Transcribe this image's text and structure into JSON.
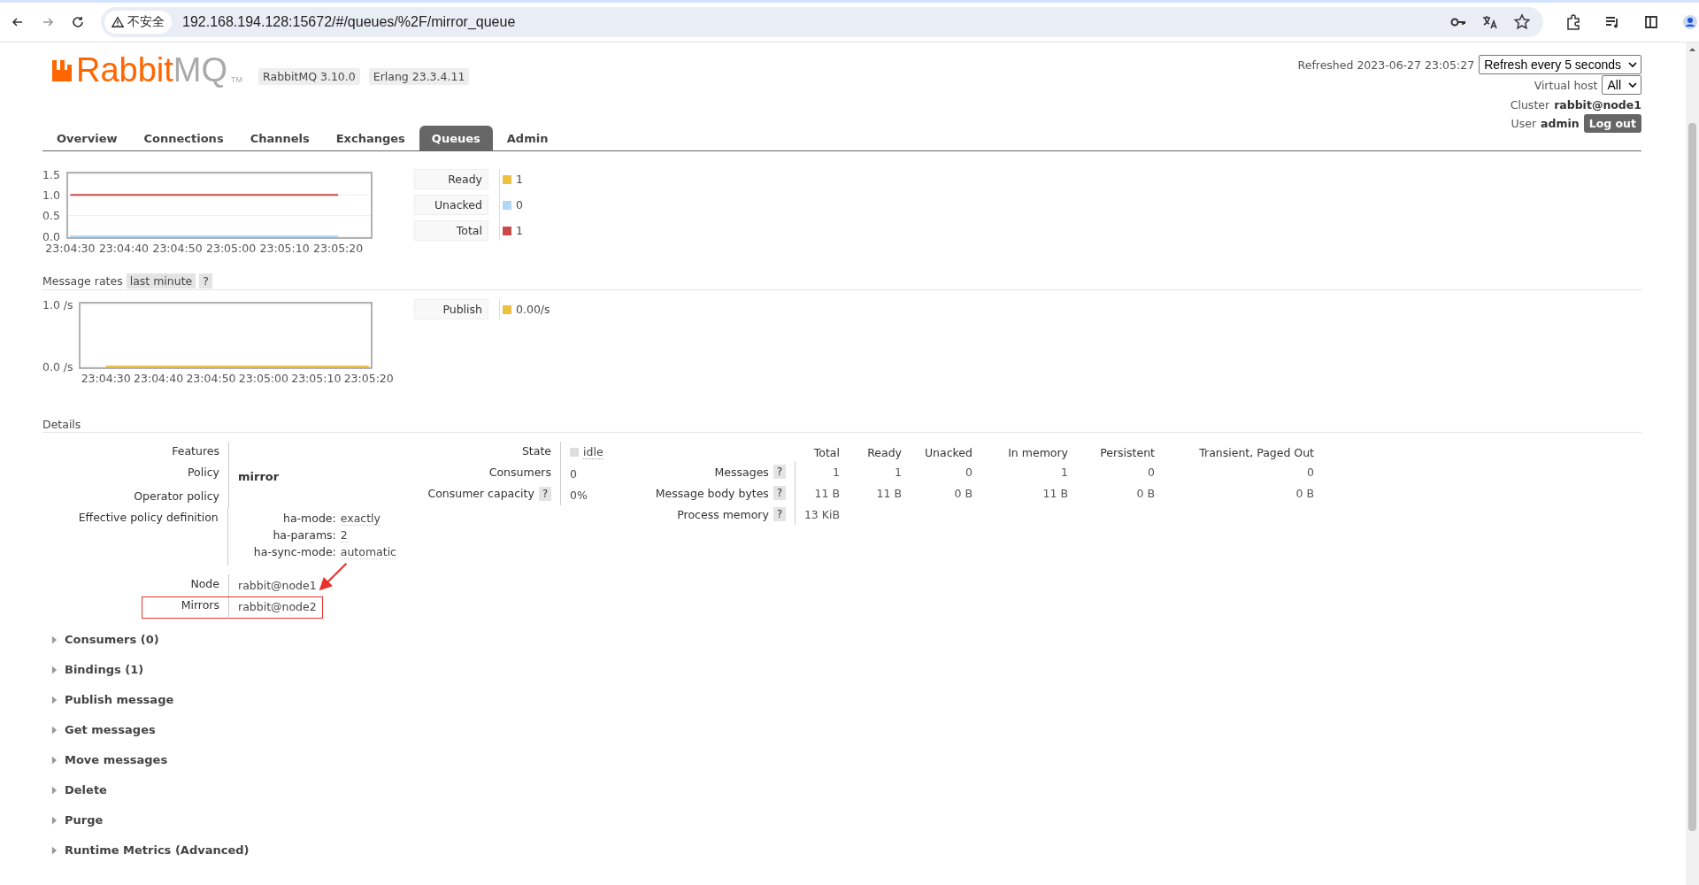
{
  "browser": {
    "security": "不安全",
    "url": "192.168.194.128:15672/#/queues/%2F/mirror_queue"
  },
  "header": {
    "logo": {
      "brand": "Rabbit",
      "suffix": "MQ",
      "tm": "TM"
    },
    "badges": [
      "RabbitMQ 3.10.0",
      "Erlang 23.3.4.11"
    ],
    "refreshed": "Refreshed 2023-06-27 23:05:27",
    "refresh_select": "Refresh every 5 seconds",
    "vhost_label": "Virtual host",
    "vhost_select": "All",
    "cluster_label": "Cluster",
    "cluster": "rabbit@node1",
    "user_label": "User",
    "user": "admin",
    "logout": "Log out"
  },
  "tabs": [
    {
      "label": "Overview",
      "selected": false
    },
    {
      "label": "Connections",
      "selected": false
    },
    {
      "label": "Channels",
      "selected": false
    },
    {
      "label": "Exchanges",
      "selected": false
    },
    {
      "label": "Queues",
      "selected": true
    },
    {
      "label": "Admin",
      "selected": false
    }
  ],
  "queued": {
    "legend": [
      {
        "value": "1"
      },
      {
        "value": "0"
      },
      {
        "value": "1"
      }
    ],
    "chart_data": {
      "type": "line",
      "categories": [
        "23:04:30",
        "23:04:40",
        "23:04:50",
        "23:05:00",
        "23:05:10",
        "23:05:20"
      ],
      "series": [
        {
          "name": "Ready",
          "color": "#edc240",
          "values": [
            null,
            null,
            null,
            null,
            null,
            null
          ]
        },
        {
          "name": "Unacked",
          "color": "#afd8f8",
          "values": [
            0,
            0,
            0,
            0,
            0,
            0
          ]
        },
        {
          "name": "Total",
          "color": "#cb4b4b",
          "values": [
            1,
            1,
            1,
            1,
            1,
            1
          ]
        }
      ],
      "ylim": [
        0,
        1.5
      ],
      "yticks": [
        {
          "value": 0,
          "label": "0.0"
        },
        {
          "value": 0.5,
          "label": "0.5"
        },
        {
          "value": 1,
          "label": "1.0"
        },
        {
          "value": 1.5,
          "label": "1.5"
        }
      ]
    }
  },
  "rates": {
    "title": "Message rates",
    "range": "last minute",
    "help": "?",
    "legend": [
      {
        "value": "0.00/s"
      }
    ],
    "chart_data": {
      "type": "line",
      "categories": [
        "23:04:30",
        "23:04:40",
        "23:04:50",
        "23:05:00",
        "23:05:10",
        "23:05:20"
      ],
      "series": [
        {
          "name": "Publish",
          "color": "#edc240",
          "values": [
            0,
            0,
            0,
            0,
            0,
            0
          ]
        }
      ],
      "ylim": [
        0,
        1
      ],
      "yticks": [
        {
          "value": 0,
          "label": "0.0 /s"
        },
        {
          "value": 1,
          "label": "1.0 /s"
        }
      ]
    }
  },
  "details": {
    "title": "Details",
    "left": [
      {
        "label": "Features",
        "kind": "plain"
      },
      {
        "label": "Policy",
        "kind": "bold",
        "value": "mirror"
      },
      {
        "label": "Operator policy",
        "kind": "plain"
      },
      {
        "label": "Effective policy definition",
        "kind": "definition",
        "children": [
          {
            "key": "ha-mode:",
            "value": "exactly"
          },
          {
            "key": "ha-params:",
            "value": "2"
          },
          {
            "key": "ha-sync-mode:",
            "value": "automatic"
          }
        ]
      },
      {
        "label": "Node",
        "kind": "plain",
        "value": "rabbit@node1"
      },
      {
        "label": "Mirrors",
        "kind": "plain",
        "value": "rabbit@node2",
        "highlighted": true
      }
    ],
    "middle": [
      {
        "label": "State",
        "kind": "state",
        "value": "idle"
      },
      {
        "label": "Consumers",
        "kind": "plain",
        "value": "0"
      },
      {
        "label": "Consumer capacity",
        "kind": "plain",
        "help": "?",
        "value": "0%"
      }
    ],
    "stats": {
      "columns": [
        "Total",
        "Ready",
        "Unacked",
        "In memory",
        "Persistent",
        "Transient, Paged Out"
      ],
      "rows": [
        {
          "label": "Messages",
          "help": "?",
          "cells": [
            "1",
            "1",
            "0",
            "1",
            "0",
            "0"
          ]
        },
        {
          "label": "Message body bytes",
          "help": "?",
          "cells": [
            "11 B",
            "11 B",
            "0 B",
            "11 B",
            "0 B",
            "0 B"
          ]
        },
        {
          "label": "Process memory",
          "help": "?",
          "cells": [
            "13 KiB"
          ]
        }
      ]
    }
  },
  "sections": [
    {
      "label": "Consumers (0)",
      "expanded": false
    },
    {
      "label": "Bindings (1)",
      "expanded": false
    },
    {
      "label": "Publish message",
      "expanded": false
    },
    {
      "label": "Get messages",
      "expanded": false
    },
    {
      "label": "Move messages",
      "expanded": false
    },
    {
      "label": "Delete",
      "expanded": false
    },
    {
      "label": "Purge",
      "expanded": false
    },
    {
      "label": "Runtime Metrics (Advanced)",
      "expanded": false
    }
  ]
}
